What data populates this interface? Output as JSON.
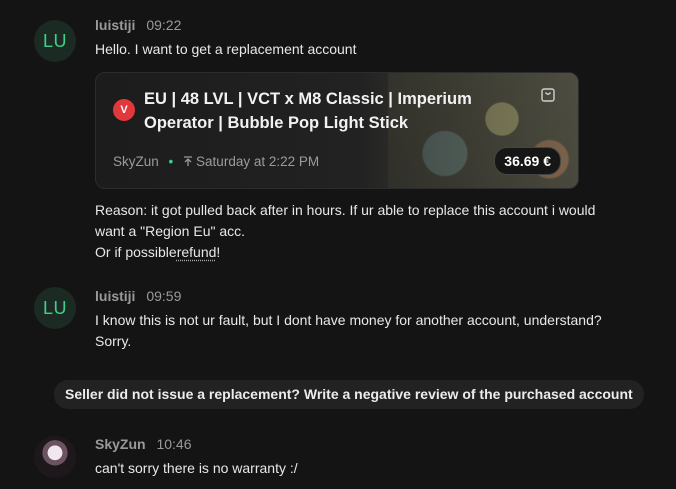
{
  "messages": [
    {
      "author": "luistiji",
      "avatar_text": "LU",
      "time": "09:22",
      "first_line": "Hello. I want to get a replacement account",
      "product": {
        "title": "EU | 48 LVL | VCT x M8 Classic | Imperium Operator | Bubble Pop Light Stick",
        "seller": "SkyZun",
        "posted": "Saturday at 2:22 PM",
        "price": "36.69 €",
        "game_icon": "valorant-icon",
        "action_icon": "shopping-bag-icon"
      },
      "reason_line1": "Reason: it got pulled back after in hours. If ur able to replace this account i would",
      "reason_line2": "want a \"Region Eu\" acc.",
      "reason_line3_prefix": "Or if possible",
      "reason_line3_link": "refund",
      "reason_line3_suffix": "!"
    },
    {
      "author": "luistiji",
      "avatar_text": "LU",
      "time": "09:59",
      "line1": "I know this is not ur fault, but I dont have money for another account, understand?",
      "line2": "Sorry."
    },
    {
      "author": "SkyZun",
      "time": "10:46",
      "line1": "can't sorry there is no warranty :/"
    }
  ],
  "notice": "Seller did not issue a replacement? Write a negative review of the purchased account",
  "colors": {
    "background": "#141414",
    "avatar_text": "#3fd08a",
    "game_badge": "#e0383b"
  }
}
